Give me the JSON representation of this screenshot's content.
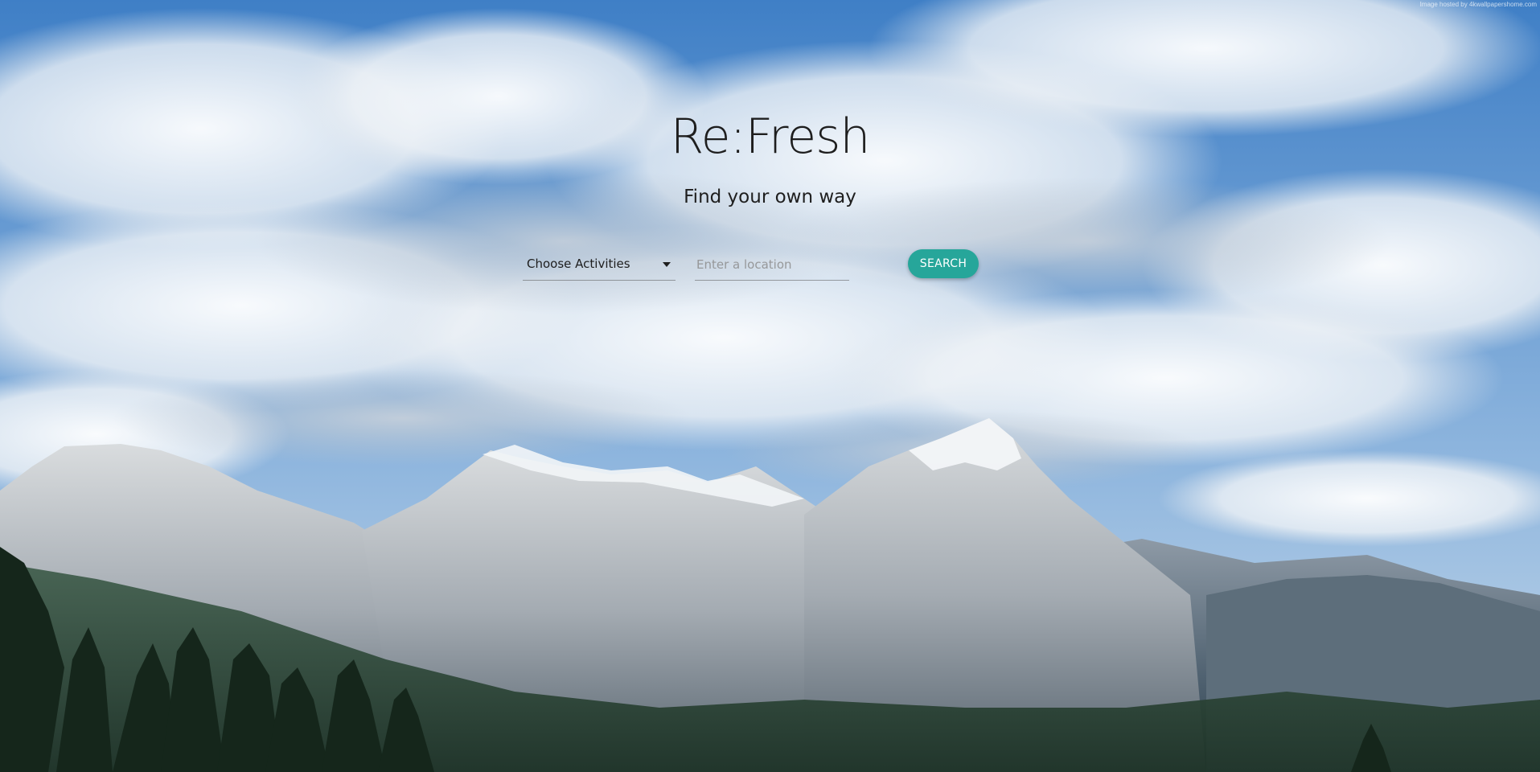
{
  "hero": {
    "title": "Re:Fresh",
    "subtitle": "Find your own way"
  },
  "search_form": {
    "activities_select": {
      "selected": "Choose Activities",
      "icon": "arrow-drop-down-icon"
    },
    "location_input": {
      "value": "",
      "placeholder": "Enter a location"
    },
    "search_button_label": "SEARCH"
  },
  "background": {
    "credit_text": "Image hosted by 4kwallpapershome.com"
  },
  "colors": {
    "accent": "#26a69a",
    "text": "#1e1e1e",
    "sky": "#4a8bd0"
  }
}
